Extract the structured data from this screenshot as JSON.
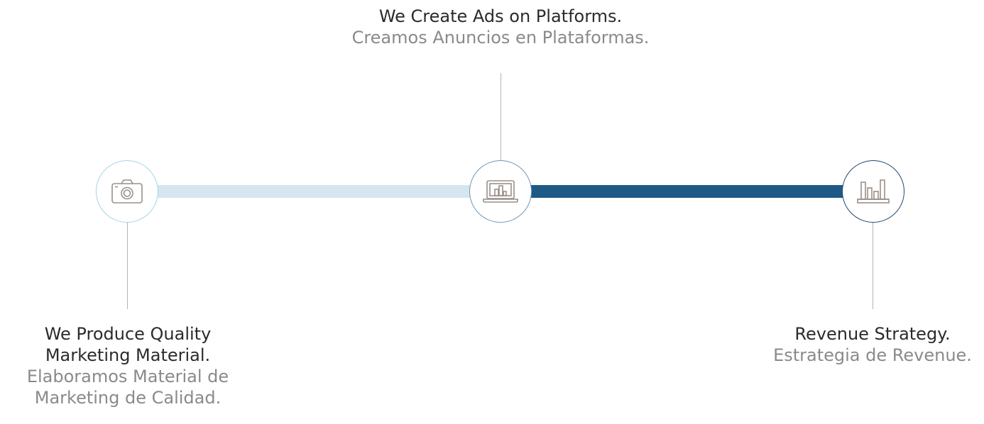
{
  "steps": [
    {
      "title": "We Produce Quality Marketing Material.",
      "title_line1": "We Produce Quality",
      "title_line2": "Marketing Material.",
      "subtitle_line1": "Elaboramos Material de",
      "subtitle_line2": "Marketing de Calidad.",
      "icon": "camera-icon"
    },
    {
      "title": "We Create Ads on Platforms.",
      "subtitle": "Creamos Anuncios en Plataformas.",
      "icon": "laptop-chart-icon"
    },
    {
      "title": "Revenue Strategy.",
      "subtitle": "Estrategia de Revenue.",
      "icon": "bar-chart-icon"
    }
  ],
  "colors": {
    "bar_light": "#d5e6f0",
    "bar_dark": "#1f5986",
    "node1_border": "#a8d3e6",
    "node2_border": "#6f97b8",
    "node3_border": "#1f4a72",
    "icon_stroke": "#9a8f89",
    "title": "#2b2b2b",
    "subtitle": "#8a8a8a"
  }
}
